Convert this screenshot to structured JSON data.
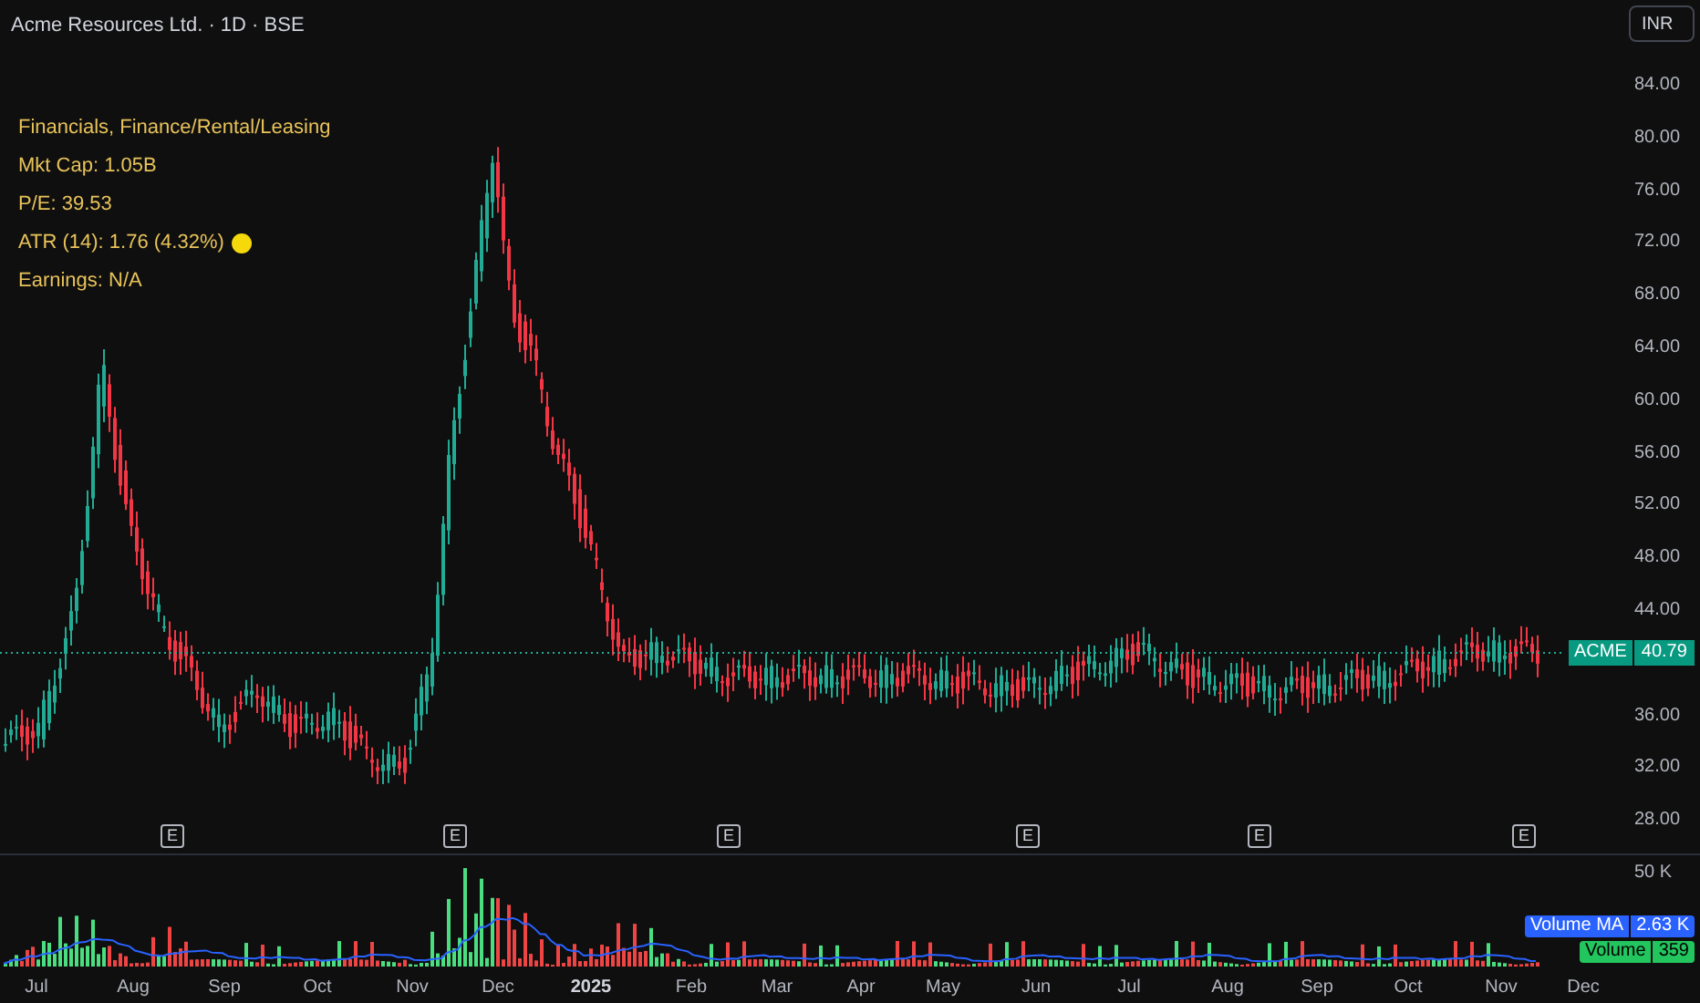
{
  "header": {
    "title": "Acme Resources Ltd. · 1D · BSE",
    "currency_button": "INR"
  },
  "info_lines": [
    {
      "text": "Financials, Finance/Rental/Leasing"
    },
    {
      "text": "Mkt Cap: 1.05B"
    },
    {
      "text": "P/E: 39.53"
    },
    {
      "text": "ATR (14): 1.76 (4.32%)",
      "color": "#f5d90a"
    },
    {
      "text": "Earnings: N/A"
    }
  ],
  "price_axis": [
    "84.00",
    "80.00",
    "76.00",
    "72.00",
    "68.00",
    "64.00",
    "60.00",
    "56.00",
    "52.00",
    "48.00",
    "44.00",
    "36.00",
    "32.00",
    "28.00"
  ],
  "last_price": {
    "symbol": "ACME",
    "price": "40.79"
  },
  "earnings_markers": [
    "E",
    "E",
    "E",
    "E",
    "E",
    "E"
  ],
  "volume_axis": [
    "50 K"
  ],
  "volume_legend": [
    {
      "label": "Volume MA",
      "value": "2.63 K",
      "color": "#2962ff"
    },
    {
      "label": "Volume",
      "value": "359",
      "color": "#22c55e"
    }
  ],
  "time_axis": [
    {
      "label": "Jul",
      "kind": "month"
    },
    {
      "label": "Aug",
      "kind": "month"
    },
    {
      "label": "Sep",
      "kind": "month"
    },
    {
      "label": "Oct",
      "kind": "month"
    },
    {
      "label": "Nov",
      "kind": "month"
    },
    {
      "label": "Dec",
      "kind": "month"
    },
    {
      "label": "2025",
      "kind": "year"
    },
    {
      "label": "Feb",
      "kind": "month"
    },
    {
      "label": "Mar",
      "kind": "month"
    },
    {
      "label": "Apr",
      "kind": "month"
    },
    {
      "label": "May",
      "kind": "month"
    },
    {
      "label": "Jun",
      "kind": "month"
    },
    {
      "label": "Jul",
      "kind": "month"
    },
    {
      "label": "Aug",
      "kind": "month"
    },
    {
      "label": "Sep",
      "kind": "month"
    },
    {
      "label": "Oct",
      "kind": "month"
    },
    {
      "label": "Nov",
      "kind": "month"
    },
    {
      "label": "Dec",
      "kind": "month"
    }
  ]
}
